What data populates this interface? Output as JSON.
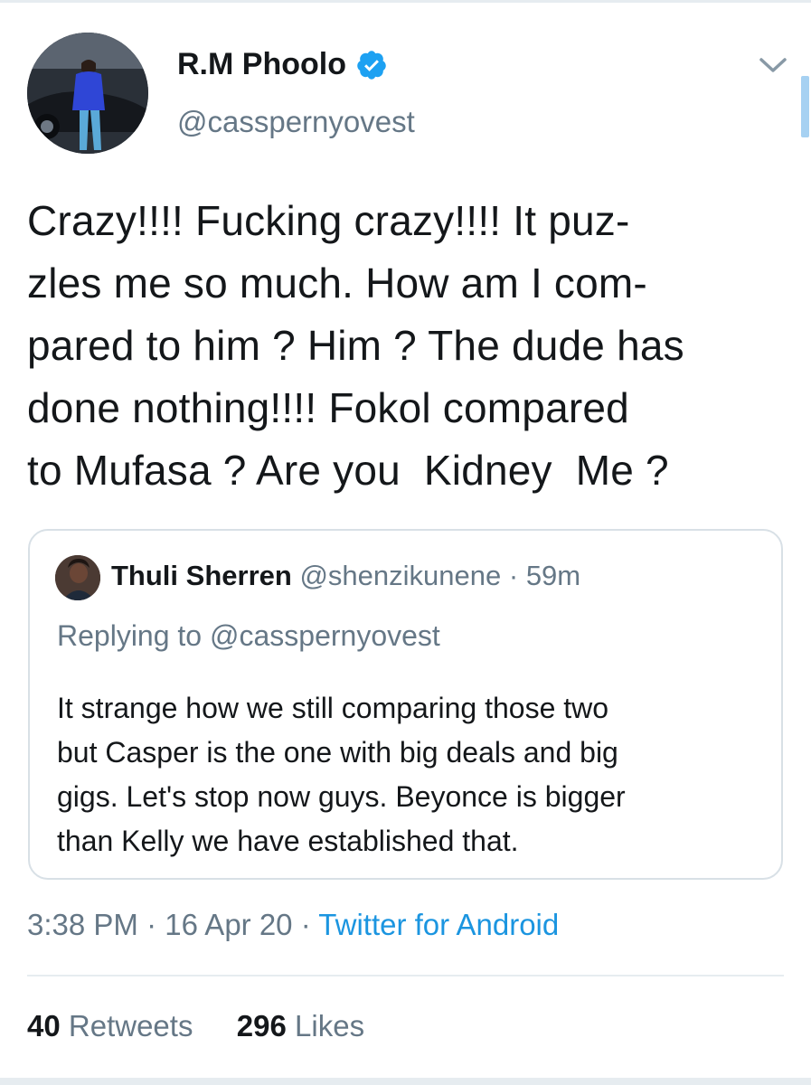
{
  "author": {
    "display_name": "R.M Phoolo",
    "handle": "@casspernyovest",
    "verified": true,
    "avatar_icon": "profile-photo"
  },
  "tweet": {
    "lines": [
      "Crazy!!!! Fucking crazy!!!! It puz-",
      "zles me so much. How am I com-",
      "pared to him ? Him ? The dude has",
      "done nothing!!!! Fokol compared",
      "to Mufasa ? Are you  Kidney  Me ?"
    ]
  },
  "quoted_tweet": {
    "display_name": "Thuli Sherren",
    "handle": "@shenzikunene",
    "separator": "·",
    "age": "59m",
    "replying_to": "Replying to @casspernyovest",
    "lines": [
      "It strange how we still comparing those two",
      "but Casper is the one with big deals and big",
      "gigs. Let's stop now guys. Beyonce is bigger",
      "than Kelly we have established that."
    ]
  },
  "meta": {
    "time": "3:38 PM",
    "separator": "·",
    "date": "16 Apr 20",
    "source": "Twitter for Android"
  },
  "stats": {
    "retweets_count": "40",
    "retweets_label": "Retweets",
    "likes_count": "296",
    "likes_label": "Likes"
  },
  "colors": {
    "accent": "#1da1f2",
    "link": "#1b95e0",
    "text_primary": "#14171a",
    "text_secondary": "#657786",
    "border": "#d8e0e6"
  },
  "icons": {
    "verified": "verified-badge-icon",
    "menu": "chevron-down-icon"
  }
}
